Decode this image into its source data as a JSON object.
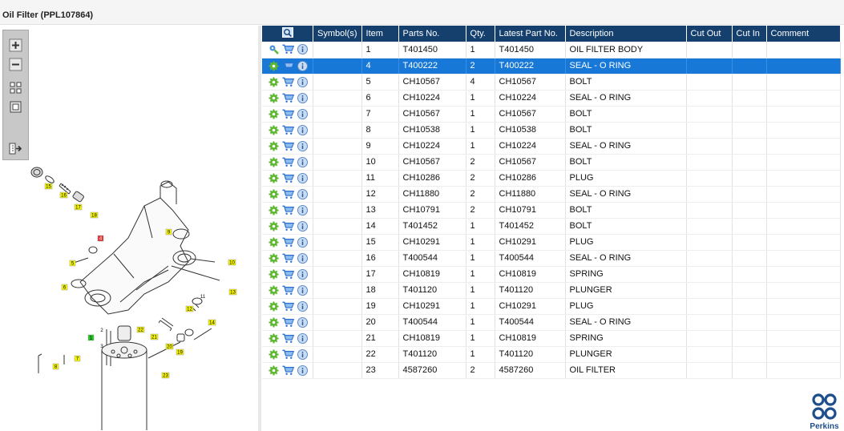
{
  "window": {
    "title": "Oil Filter (PPL107864)"
  },
  "toolbar": {
    "buttons": [
      "zoom-in",
      "zoom-out",
      "fit-all",
      "fit-window",
      "export"
    ]
  },
  "table": {
    "columns": [
      "",
      "Symbol(s)",
      "Item",
      "Parts No.",
      "Qty.",
      "Latest Part No.",
      "Description",
      "Cut Out",
      "Cut In",
      "Comment"
    ],
    "selected_item": "4",
    "rows": [
      {
        "item": "1",
        "part": "T401450",
        "qty": "1",
        "latest": "T401450",
        "desc": "OIL FILTER BODY"
      },
      {
        "item": "4",
        "part": "T400222",
        "qty": "2",
        "latest": "T400222",
        "desc": "SEAL - O RING"
      },
      {
        "item": "5",
        "part": "CH10567",
        "qty": "4",
        "latest": "CH10567",
        "desc": "BOLT"
      },
      {
        "item": "6",
        "part": "CH10224",
        "qty": "1",
        "latest": "CH10224",
        "desc": "SEAL - O RING"
      },
      {
        "item": "7",
        "part": "CH10567",
        "qty": "1",
        "latest": "CH10567",
        "desc": "BOLT"
      },
      {
        "item": "8",
        "part": "CH10538",
        "qty": "1",
        "latest": "CH10538",
        "desc": "BOLT"
      },
      {
        "item": "9",
        "part": "CH10224",
        "qty": "1",
        "latest": "CH10224",
        "desc": "SEAL - O RING"
      },
      {
        "item": "10",
        "part": "CH10567",
        "qty": "2",
        "latest": "CH10567",
        "desc": "BOLT"
      },
      {
        "item": "11",
        "part": "CH10286",
        "qty": "2",
        "latest": "CH10286",
        "desc": "PLUG"
      },
      {
        "item": "12",
        "part": "CH11880",
        "qty": "2",
        "latest": "CH11880",
        "desc": "SEAL - O RING"
      },
      {
        "item": "13",
        "part": "CH10791",
        "qty": "2",
        "latest": "CH10791",
        "desc": "BOLT"
      },
      {
        "item": "14",
        "part": "T401452",
        "qty": "1",
        "latest": "T401452",
        "desc": "BOLT"
      },
      {
        "item": "15",
        "part": "CH10291",
        "qty": "1",
        "latest": "CH10291",
        "desc": "PLUG"
      },
      {
        "item": "16",
        "part": "T400544",
        "qty": "1",
        "latest": "T400544",
        "desc": "SEAL - O RING"
      },
      {
        "item": "17",
        "part": "CH10819",
        "qty": "1",
        "latest": "CH10819",
        "desc": "SPRING"
      },
      {
        "item": "18",
        "part": "T401120",
        "qty": "1",
        "latest": "T401120",
        "desc": "PLUNGER"
      },
      {
        "item": "19",
        "part": "CH10291",
        "qty": "1",
        "latest": "CH10291",
        "desc": "PLUG"
      },
      {
        "item": "20",
        "part": "T400544",
        "qty": "1",
        "latest": "T400544",
        "desc": "SEAL - O RING"
      },
      {
        "item": "21",
        "part": "CH10819",
        "qty": "1",
        "latest": "CH10819",
        "desc": "SPRING"
      },
      {
        "item": "22",
        "part": "T401120",
        "qty": "1",
        "latest": "T401120",
        "desc": "PLUNGER"
      },
      {
        "item": "23",
        "part": "4587260",
        "qty": "2",
        "latest": "4587260",
        "desc": "OIL FILTER"
      }
    ]
  },
  "diagram": {
    "callouts": [
      "15",
      "16",
      "17",
      "18",
      "9",
      "4",
      "5",
      "10",
      "6",
      "13",
      "12",
      "14",
      "22",
      "21",
      "1",
      "2",
      "3",
      "20",
      "19",
      "7",
      "8",
      "23",
      "11"
    ],
    "selected_callout": "4"
  },
  "brand": {
    "name": "Perkins"
  },
  "colors": {
    "header": "#15406e",
    "selected_row": "#1878d8",
    "callout": "#f5f500",
    "callout_selected": "#e03030"
  }
}
